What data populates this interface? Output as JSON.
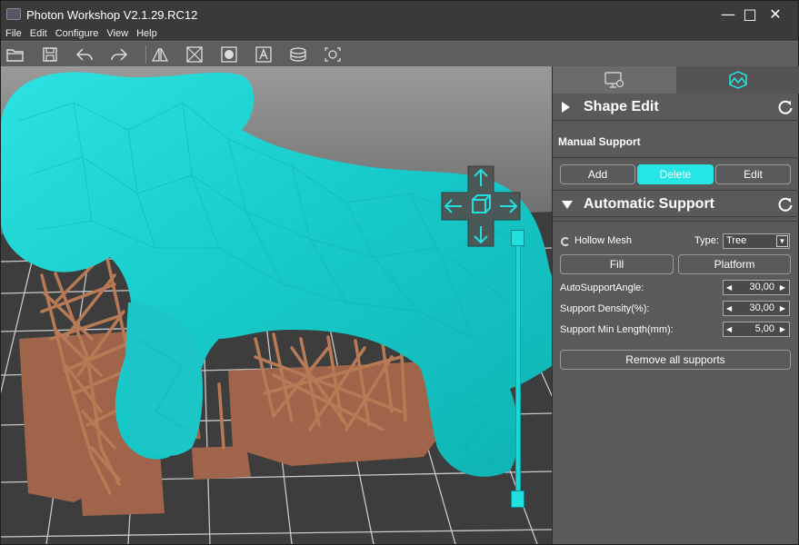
{
  "window": {
    "title": "Photon Workshop V2.1.29.RC12",
    "minimize_glyph": "—",
    "maximize_glyph": "□",
    "close_glyph": "✕"
  },
  "menu": [
    "File",
    "Edit",
    "Configure",
    "View",
    "Help"
  ],
  "toolbar": {
    "icons": [
      "open-folder-icon",
      "save-icon",
      "undo-icon",
      "redo-icon",
      "mirror-icon",
      "repair-icon",
      "hollow-icon",
      "text-icon",
      "slice-icon",
      "screenshot-icon"
    ]
  },
  "panel": {
    "tabs": [
      "print-settings-icon",
      "model-edit-icon"
    ],
    "shape_edit": {
      "title": "Shape Edit"
    },
    "manual_support": {
      "title": "Manual Support",
      "add_label": "Add",
      "delete_label": "Delete",
      "edit_label": "Edit"
    },
    "automatic_support": {
      "title": "Automatic Support",
      "hollow_mesh_label": "Hollow Mesh",
      "type_label": "Type:",
      "type_value": "Tree",
      "fill_label": "Fill",
      "platform_label": "Platform",
      "angle_label": "AutoSupportAngle:",
      "angle_value": "30,00",
      "density_label": "Support Density(%):",
      "density_value": "30,00",
      "min_length_label": "Support Min Length(mm):",
      "min_length_value": "5,00",
      "remove_label": "Remove all supports"
    }
  },
  "colors": {
    "accent": "#25e6e6",
    "model": "#1ad4d4",
    "support": "#a86a4a",
    "panel_bg": "#5a5a5a"
  }
}
